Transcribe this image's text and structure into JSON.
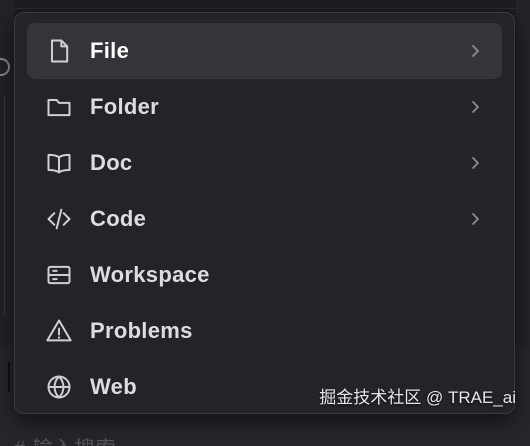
{
  "menu": {
    "items": [
      {
        "label": "File",
        "icon": "file-icon",
        "has_submenu": true,
        "active": true
      },
      {
        "label": "Folder",
        "icon": "folder-icon",
        "has_submenu": true,
        "active": false
      },
      {
        "label": "Doc",
        "icon": "book-icon",
        "has_submenu": true,
        "active": false
      },
      {
        "label": "Code",
        "icon": "code-icon",
        "has_submenu": true,
        "active": false
      },
      {
        "label": "Workspace",
        "icon": "workspace-icon",
        "has_submenu": false,
        "active": false
      },
      {
        "label": "Problems",
        "icon": "warning-icon",
        "has_submenu": false,
        "active": false
      },
      {
        "label": "Web",
        "icon": "globe-icon",
        "has_submenu": false,
        "active": false
      }
    ]
  },
  "background": {
    "input_hint": "# 输入搜索"
  },
  "watermark": "掘金技术社区 @ TRAE_ai",
  "colors": {
    "menu_bg": "#232428",
    "active_item_bg": "#34353a",
    "text": "#dcdde0",
    "icon": "#cfd0d4"
  }
}
